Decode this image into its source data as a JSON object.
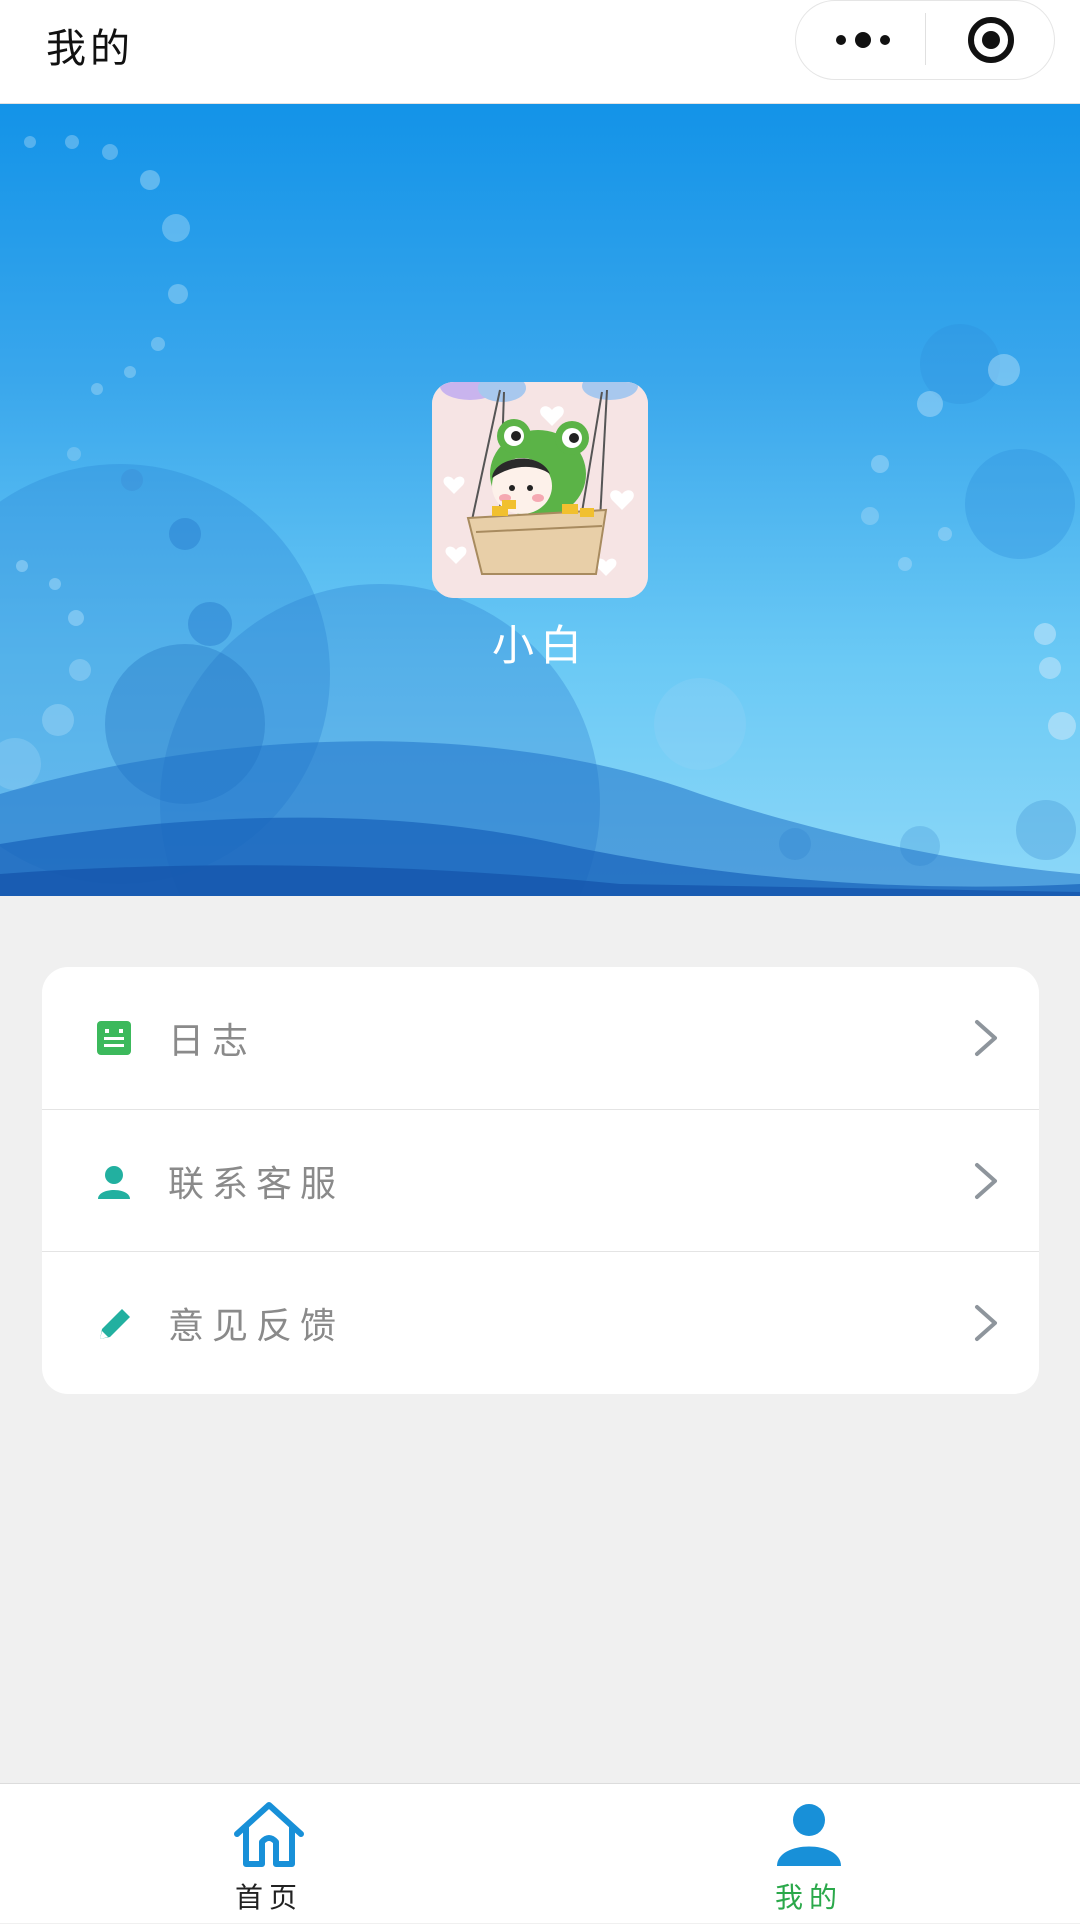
{
  "navbar": {
    "title": "我的",
    "more_icon": "more-dots-icon",
    "close_icon": "target-circle-icon"
  },
  "profile": {
    "username": "小白",
    "avatar": "frog-hood-avatar-image"
  },
  "menu": {
    "items": [
      {
        "label": "日志",
        "icon": "log-notebook-icon",
        "icon_color": "#3cb95c"
      },
      {
        "label": "联系客服",
        "icon": "person-icon",
        "icon_color": "#22b0a0"
      },
      {
        "label": "意见反馈",
        "icon": "pencil-icon",
        "icon_color": "#22b0a0"
      }
    ]
  },
  "tabbar": {
    "tabs": [
      {
        "label": "首页",
        "icon": "home-icon",
        "color": "#1890d8",
        "selected": false
      },
      {
        "label": "我的",
        "icon": "user-icon",
        "color": "#1890d8",
        "selected": true,
        "label_color": "#2aa84a"
      }
    ]
  },
  "colors": {
    "banner_top": "#1393e8",
    "banner_bottom": "#8dd8f8",
    "page_background": "#f0f0f0"
  }
}
